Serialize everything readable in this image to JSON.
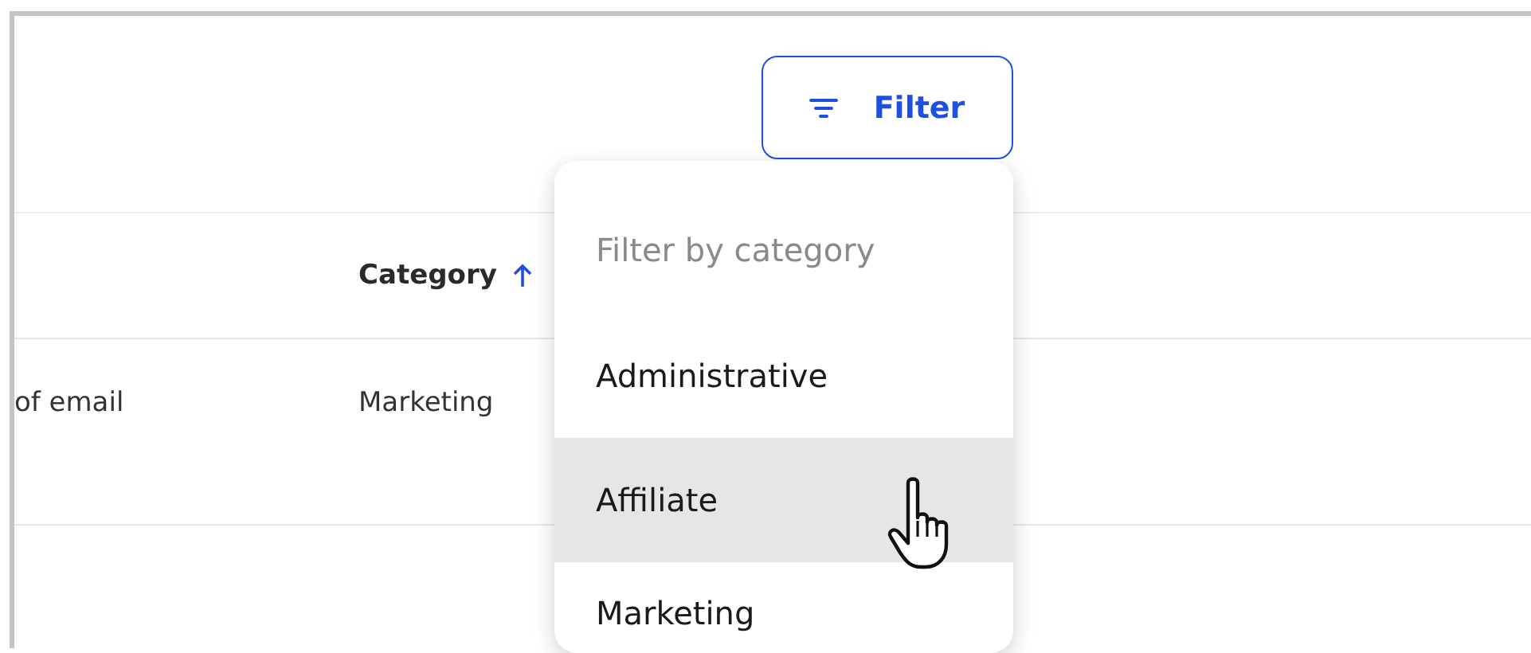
{
  "filter_button": {
    "label": "Filter"
  },
  "table": {
    "columns": [
      {},
      {
        "label": "Category",
        "sort_ascending": true
      }
    ],
    "rows": [
      {
        "cells": [
          "of email",
          "Marketing"
        ]
      }
    ]
  },
  "filter_menu": {
    "heading": "Filter by category",
    "items": [
      {
        "label": "Administrative",
        "hovered": false
      },
      {
        "label": "Affiliate",
        "hovered": true
      },
      {
        "label": "Marketing",
        "hovered": false
      }
    ]
  }
}
